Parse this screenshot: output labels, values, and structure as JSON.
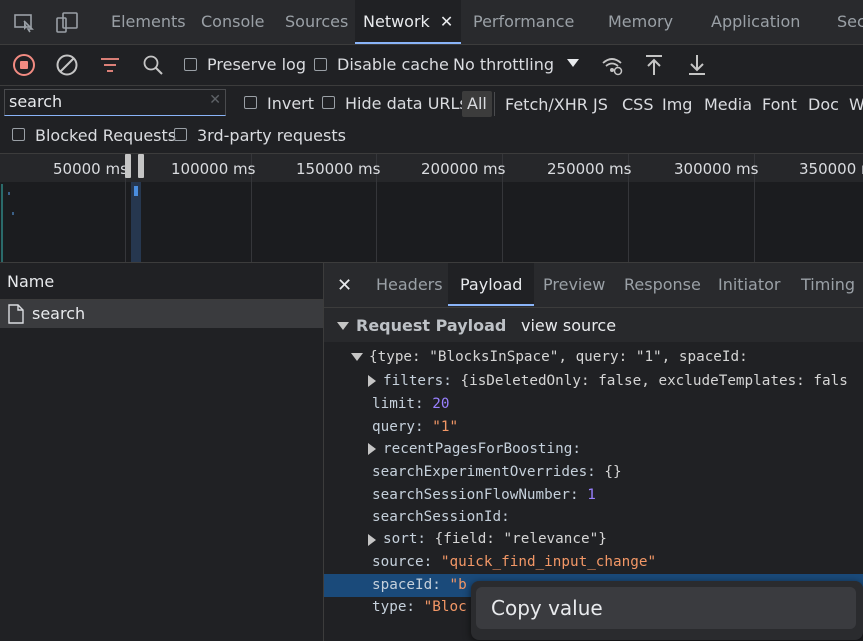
{
  "tabs": [
    {
      "label": "Elements"
    },
    {
      "label": "Console"
    },
    {
      "label": "Sources"
    },
    {
      "label": "Network",
      "active": true
    },
    {
      "label": "Performance"
    },
    {
      "label": "Memory"
    },
    {
      "label": "Application"
    },
    {
      "label": "Sec"
    }
  ],
  "toolbar": {
    "preserve_log": "Preserve log",
    "disable_cache": "Disable cache",
    "throttling": "No throttling"
  },
  "filter": {
    "search_value": "search",
    "invert": "Invert",
    "hide_data_urls": "Hide data URLs",
    "types": [
      "All",
      "Fetch/XHR",
      "JS",
      "CSS",
      "Img",
      "Media",
      "Font",
      "Doc",
      "W"
    ]
  },
  "row3": {
    "blocked": "Blocked Requests",
    "third_party": "3rd-party requests"
  },
  "timeline": {
    "ticks": [
      "50000 ms",
      "100000 ms",
      "150000 ms",
      "200000 ms",
      "250000 ms",
      "300000 ms",
      "350000 ms"
    ]
  },
  "requests": {
    "header": "Name",
    "items": [
      {
        "name": "search"
      }
    ]
  },
  "detail": {
    "tabs": [
      "Headers",
      "Payload",
      "Preview",
      "Response",
      "Initiator",
      "Timing"
    ],
    "active_tab": "Payload",
    "section_title": "Request Payload",
    "view_source": "view source",
    "payload": {
      "root_summary": "{type: \"BlocksInSpace\", query: \"1\", spaceId:",
      "filters_key": "filters:",
      "filters_val": "{isDeletedOnly: false, excludeTemplates: fals",
      "limit_key": "limit:",
      "limit_val": "20",
      "query_key": "query:",
      "query_val": "\"1\"",
      "recent_key": "recentPagesForBoosting:",
      "overrides_key": "searchExperimentOverrides:",
      "overrides_val": "{}",
      "flow_key": "searchSessionFlowNumber:",
      "flow_val": "1",
      "session_key": "searchSessionId:",
      "sort_key": "sort:",
      "sort_val": "{field: \"relevance\"}",
      "source_key": "source:",
      "source_val": "\"quick_find_input_change\"",
      "space_key": "spaceId:",
      "space_val": "\"b",
      "type_key": "type:",
      "type_val": "\"Bloc"
    }
  },
  "context_menu": {
    "copy_value": "Copy value"
  },
  "colors": {
    "accent": "#8ab4f8",
    "record": "#f28b82",
    "filter_icon": "#f28b82",
    "selected_row": "#1a4a7a"
  }
}
